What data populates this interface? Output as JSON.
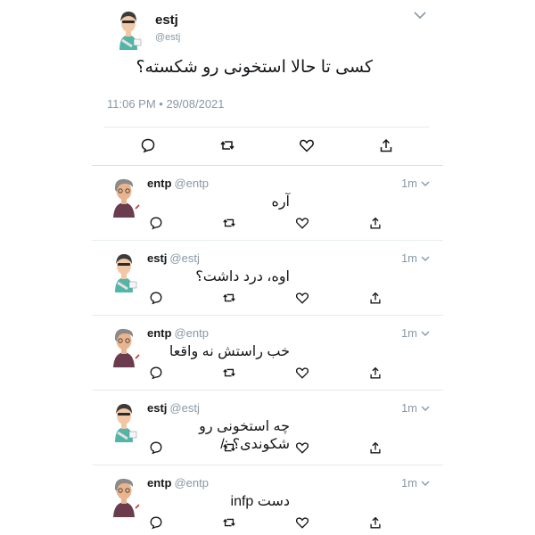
{
  "main_tweet": {
    "name": "estj",
    "handle": "@estj",
    "text": "کسی تا حالا استخونی رو شکسته؟",
    "timestamp": "11:06 PM • 29/08/2021",
    "actions": [
      "reply-icon",
      "retweet-icon",
      "like-icon",
      "share-icon"
    ]
  },
  "replies": [
    {
      "name": "entp",
      "handle": "@entp",
      "time": "1m",
      "text": "آره",
      "avatar": "entp"
    },
    {
      "name": "estj",
      "handle": "@estj",
      "time": "1m",
      "text": "اوه، درد داشت؟",
      "avatar": "estj"
    },
    {
      "name": "entp",
      "handle": "@entp",
      "time": "1m",
      "text": "خب راستش نه واقعا",
      "avatar": "entp"
    },
    {
      "name": "estj",
      "handle": "@estj",
      "time": "1m",
      "text": "چه استخونی رو شکوندی؟ :/",
      "avatar": "estj"
    },
    {
      "name": "entp",
      "handle": "@entp",
      "time": "1m",
      "text": "دست infp",
      "avatar": "entp"
    }
  ],
  "colors": {
    "secondary_text": "#8899a6",
    "primary_text": "#14171a",
    "divider": "#e6ecf0"
  }
}
